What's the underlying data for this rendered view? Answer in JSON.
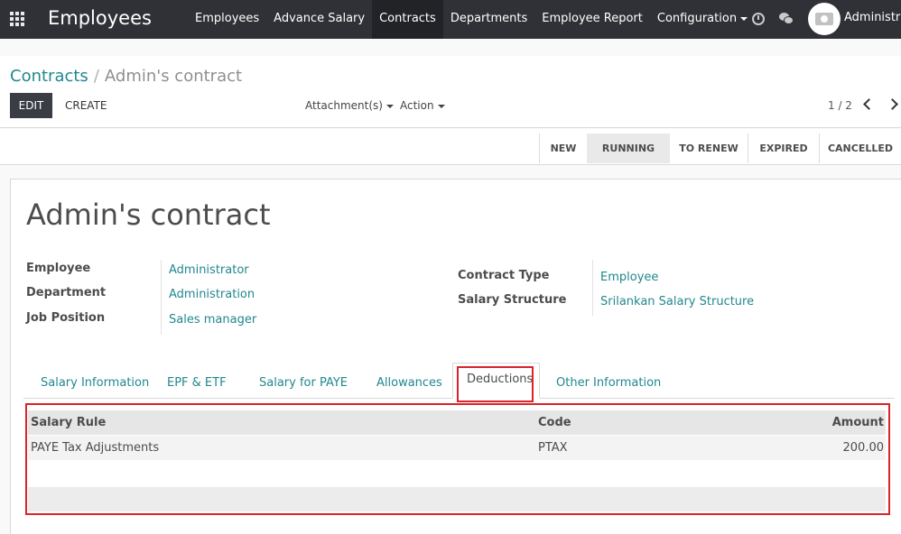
{
  "navbar": {
    "app_title": "Employees",
    "menu": [
      {
        "label": "Employees"
      },
      {
        "label": "Advance Salary"
      },
      {
        "label": "Contracts"
      },
      {
        "label": "Departments"
      },
      {
        "label": "Employee Report"
      },
      {
        "label": "Configuration"
      }
    ],
    "active_menu": "Contracts",
    "user_name": "Administrat"
  },
  "breadcrumb": {
    "parent": "Contracts",
    "separator": "/",
    "current": "Admin's contract"
  },
  "toolbar": {
    "edit_label": "EDIT",
    "create_label": "CREATE",
    "attachments_label": "Attachment(s)",
    "action_label": "Action",
    "pager": "1 / 2"
  },
  "status_stages": [
    {
      "label": "NEW"
    },
    {
      "label": "RUNNING"
    },
    {
      "label": "TO RENEW"
    },
    {
      "label": "EXPIRED"
    },
    {
      "label": "CANCELLED"
    }
  ],
  "active_stage": "RUNNING",
  "form": {
    "title": "Admin's contract",
    "left_fields": [
      {
        "label": "Employee",
        "value": "Administrator"
      },
      {
        "label": "Department",
        "value": "Administration"
      },
      {
        "label": "Job Position",
        "value": "Sales manager"
      }
    ],
    "right_fields": [
      {
        "label": "Contract Type",
        "value": "Employee"
      },
      {
        "label": "Salary Structure",
        "value": "Srilankan Salary Structure"
      }
    ]
  },
  "tabs": [
    {
      "label": "Salary Information"
    },
    {
      "label": "EPF & ETF"
    },
    {
      "label": "Salary for PAYE"
    },
    {
      "label": "Allowances"
    },
    {
      "label": "Deductions"
    },
    {
      "label": "Other Information"
    }
  ],
  "active_tab": "Deductions",
  "table": {
    "columns": [
      "Salary Rule",
      "Code",
      "Amount"
    ],
    "rows": [
      [
        "PAYE Tax Adjustments",
        "PTAX",
        "200.00"
      ]
    ]
  },
  "colors": {
    "navbar_bg": "#2f3136",
    "link": "#21878f",
    "highlight": "#d9242b"
  }
}
